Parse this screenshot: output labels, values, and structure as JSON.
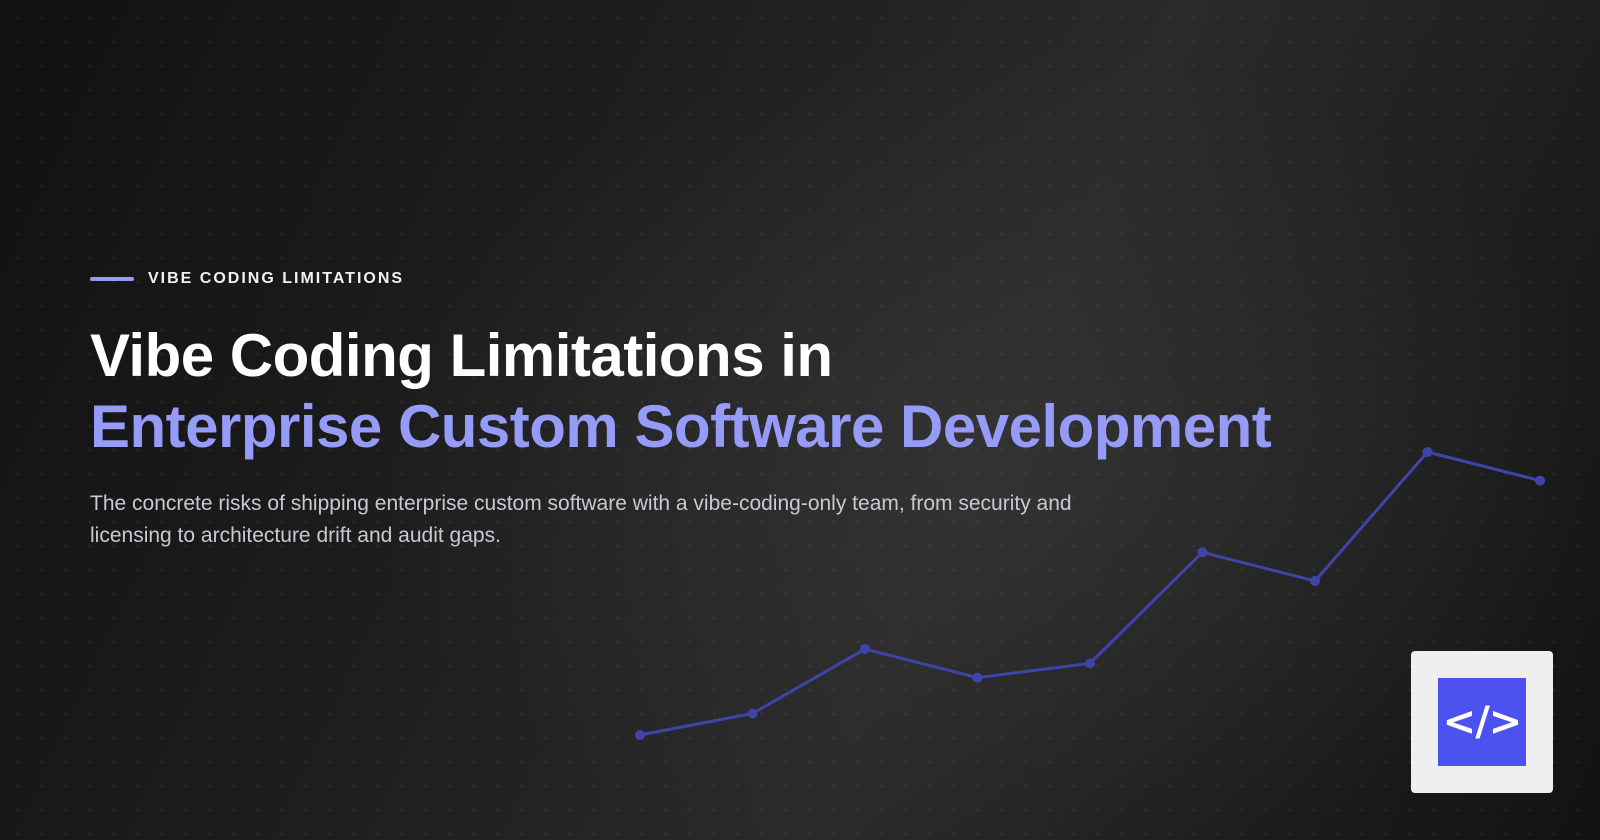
{
  "hero": {
    "eyebrow": "VIBE CODING LIMITATIONS",
    "title_line1": "Vibe Coding Limitations in",
    "title_line2": "Enterprise Custom Software Development",
    "subtitle": "The concrete risks of shipping enterprise custom software with a vibe-coding-only team, from security and licensing to architecture drift and audit gaps."
  },
  "logo": {
    "glyph": "</>",
    "icon": "code-brackets-icon"
  },
  "colors": {
    "accent": "#959bf6",
    "eyebrow_line": "#959bf6",
    "chart_line": "#3f45a8",
    "logo_bg": "#4c52ee",
    "logo_card": "#efeff0"
  },
  "decor_line": {
    "values": [
      20,
      26,
      44,
      36,
      40,
      71,
      63,
      99,
      91
    ]
  }
}
